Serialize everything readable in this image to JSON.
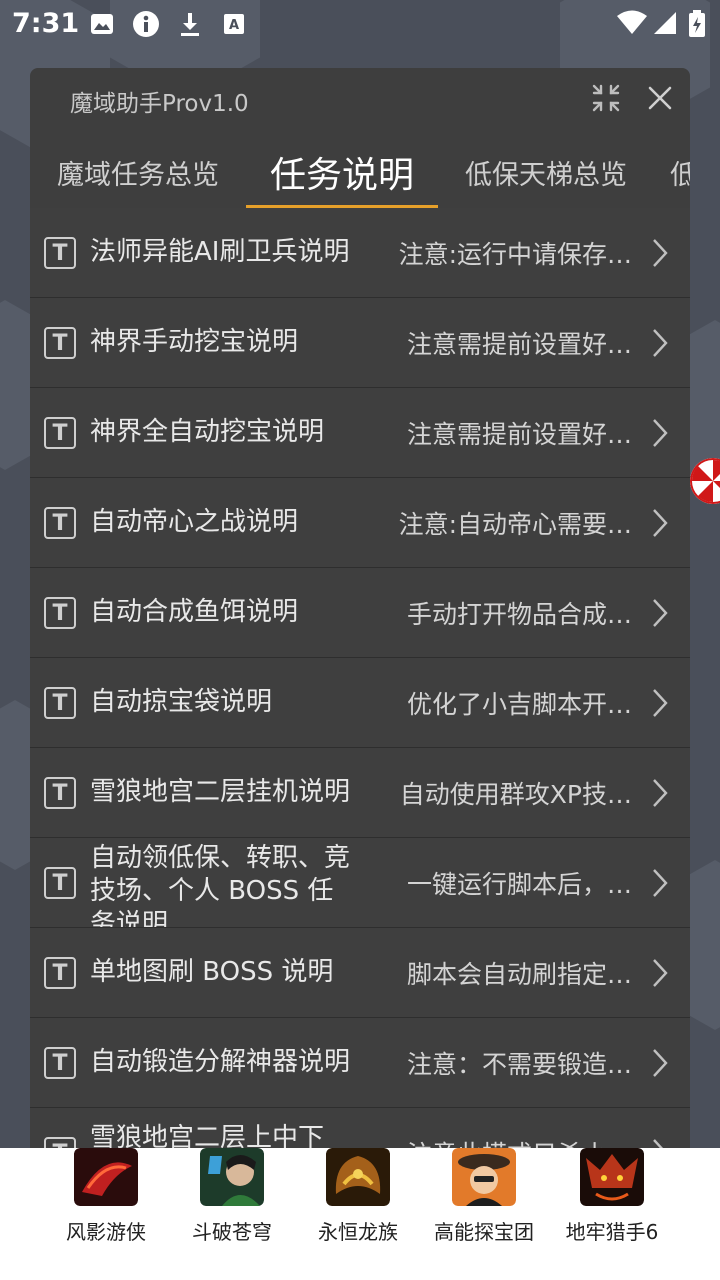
{
  "status_bar": {
    "time": "7:31"
  },
  "panel": {
    "title": "魔域助手Prov1.0"
  },
  "tabs": [
    {
      "label": "魔域任务总览",
      "active": false
    },
    {
      "label": "任务说明",
      "active": true
    },
    {
      "label": "低保天梯总览",
      "active": false
    },
    {
      "label": "低",
      "active": false
    }
  ],
  "rows": [
    {
      "title": "法师异能AI刷卫兵说明",
      "desc": "注意:运行中请保存…"
    },
    {
      "title": "神界手动挖宝说明",
      "desc": "注意需提前设置好…"
    },
    {
      "title": "神界全自动挖宝说明",
      "desc": "注意需提前设置好…"
    },
    {
      "title": "自动帝心之战说明",
      "desc": "注意:自动帝心需要…"
    },
    {
      "title": "自动合成鱼饵说明",
      "desc": "手动打开物品合成…"
    },
    {
      "title": "自动掠宝袋说明",
      "desc": "优化了小吉脚本开…"
    },
    {
      "title": "雪狼地宫二层挂机说明",
      "desc": "自动使用群攻XP技…"
    },
    {
      "title": "自动领低保、转职、竞技场、个人 BOSS 任务说明",
      "desc": "一键运行脚本后，…"
    },
    {
      "title": "单地图刷 BOSS 说明",
      "desc": "脚本会自动刷指定…"
    },
    {
      "title": "自动锻造分解神器说明",
      "desc": "注意：不需要锻造…"
    },
    {
      "title": "雪狼地宫二层上中下",
      "desc": "注意此模式只杀小…"
    }
  ],
  "games": [
    {
      "name": "风影游侠",
      "color": "#b31d1d"
    },
    {
      "name": "斗破苍穹",
      "color": "#2c6d3a"
    },
    {
      "name": "永恒龙族",
      "color": "#c98a1c"
    },
    {
      "name": "高能探宝团",
      "color": "#d45a1a"
    },
    {
      "name": "地牢猎手6",
      "color": "#b8351a"
    }
  ]
}
